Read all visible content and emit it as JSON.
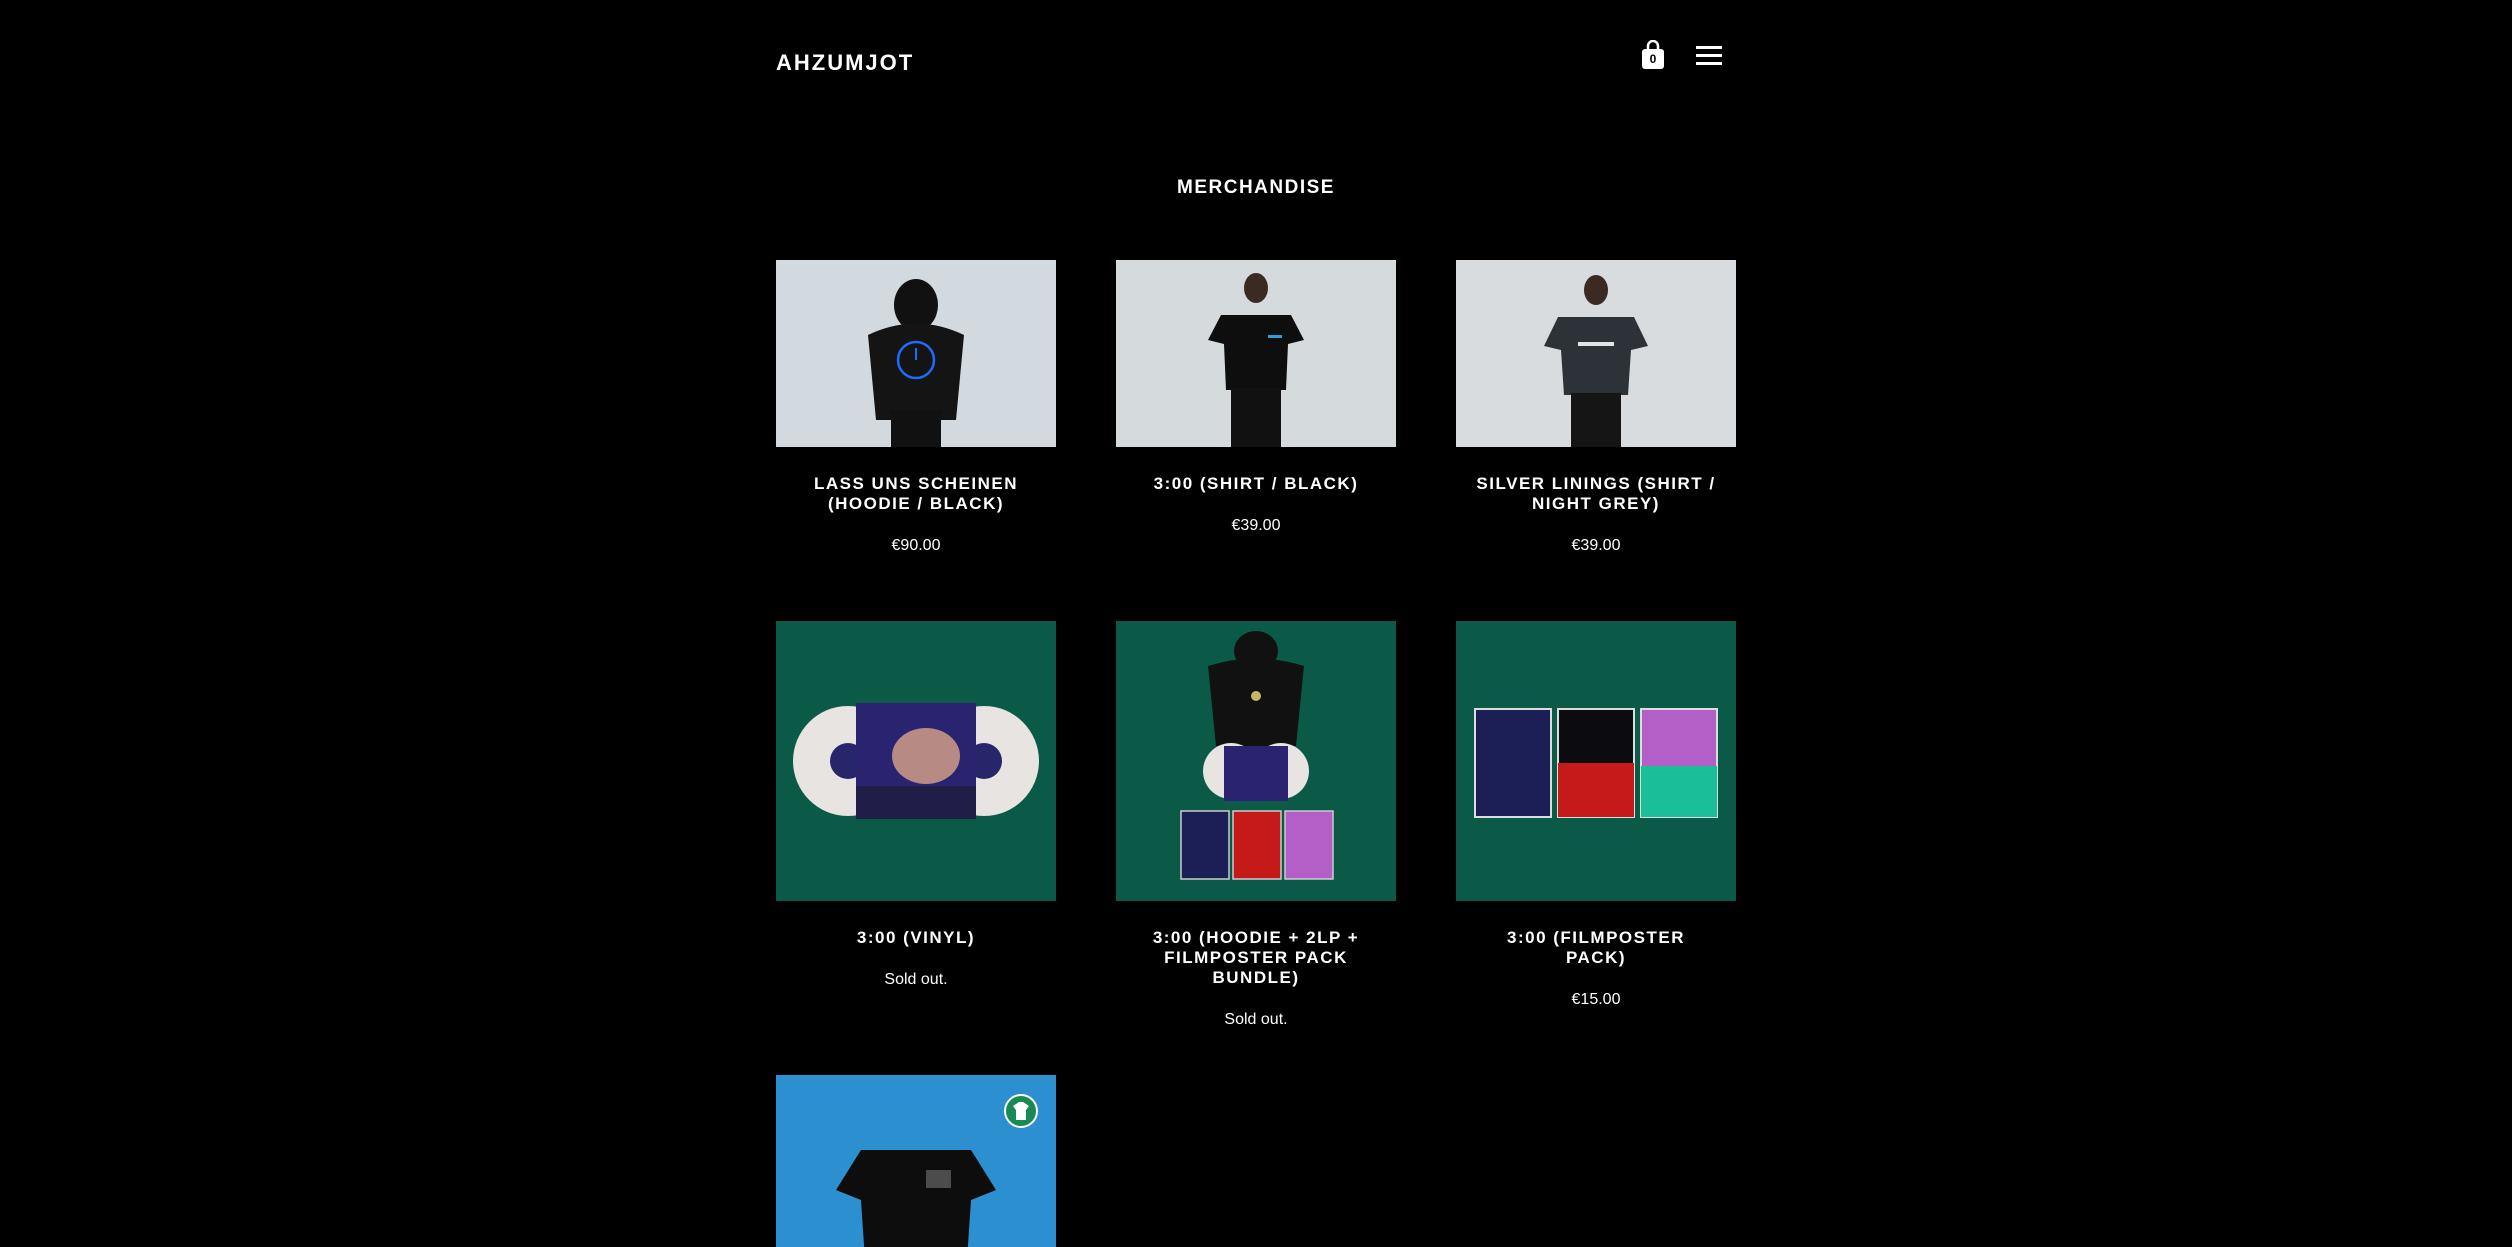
{
  "header": {
    "logo_text": "AHZUMJOT",
    "cart_count": "0"
  },
  "main": {
    "title": "MERCHANDISE",
    "products": [
      {
        "title": "LASS UNS SCHEINEN (HOODIE / BLACK)",
        "price": "€90.00"
      },
      {
        "title": "3:00 (SHIRT / BLACK)",
        "price": "€39.00"
      },
      {
        "title": "SILVER LININGS (SHIRT / NIGHT GREY)",
        "price": "€39.00"
      },
      {
        "title": "3:00 (VINYL)",
        "price": "Sold out."
      },
      {
        "title": "3:00 (HOODIE + 2LP + FILMPOSTER PACK BUNDLE)",
        "price": "Sold out."
      },
      {
        "title": "3:00 (FILMPOSTER PACK)",
        "price": "€15.00"
      }
    ]
  },
  "colors": {
    "background": "#000000",
    "text": "#ffffff",
    "product_green": "#0b5a48",
    "sky_blue": "#2b8fd0"
  }
}
